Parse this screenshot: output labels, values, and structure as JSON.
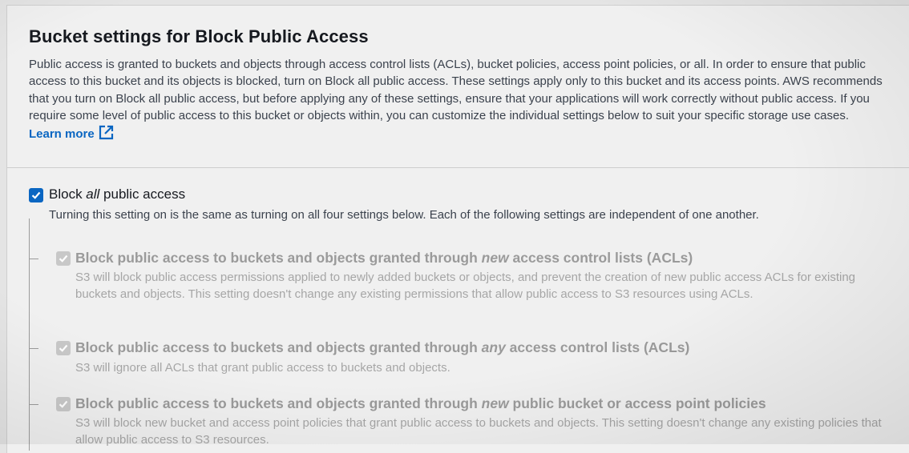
{
  "section": {
    "title": "Bucket settings for Block Public Access",
    "description": "Public access is granted to buckets and objects through access control lists (ACLs), bucket policies, access point policies, or all. In order to ensure that public access to this bucket and its objects is blocked, turn on Block all public access. These settings apply only to this bucket and its access points. AWS recommends that you turn on Block all public access, but before applying any of these settings, ensure that your applications will work correctly without public access. If you require some level of public access to this bucket or objects within, you can customize the individual settings below to suit your specific storage use cases.",
    "learn_more": "Learn more",
    "learn_more_icon": "external-link-icon"
  },
  "block_all": {
    "label_pre": "Block ",
    "label_em": "all",
    "label_post": " public access",
    "checked": true,
    "description": "Turning this setting on is the same as turning on all four settings below. Each of the following settings are independent of one another."
  },
  "settings": [
    {
      "title_pre": "Block public access to buckets and objects granted through ",
      "title_em": "new",
      "title_post": " access control lists (ACLs)",
      "checked": true,
      "description": "S3 will block public access permissions applied to newly added buckets or objects, and prevent the creation of new public access ACLs for existing buckets and objects. This setting doesn't change any existing permissions that allow public access to S3 resources using ACLs."
    },
    {
      "title_pre": "Block public access to buckets and objects granted through ",
      "title_em": "any",
      "title_post": " access control lists (ACLs)",
      "checked": true,
      "description": "S3 will ignore all ACLs that grant public access to buckets and objects."
    },
    {
      "title_pre": "Block public access to buckets and objects granted through ",
      "title_em": "new",
      "title_post": " public bucket or access point policies",
      "checked": true,
      "description": "S3 will block new bucket and access point policies that grant public access to buckets and objects. This setting doesn't change any existing policies that allow public access to S3 resources."
    }
  ],
  "colors": {
    "accent": "#0a66c2",
    "disabled_text": "#9a9a9a"
  }
}
